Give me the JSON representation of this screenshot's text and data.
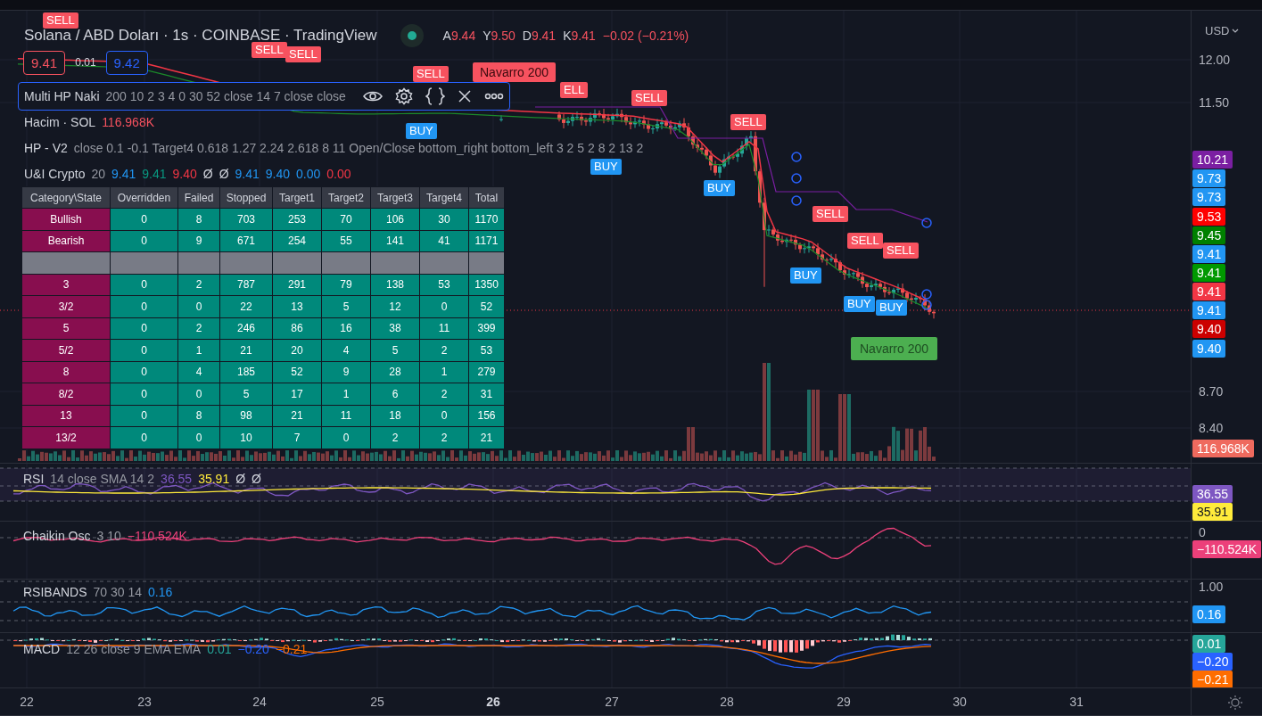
{
  "header": {
    "title": "Solana / ABD Doları · 1s · COINBASE · TradingView",
    "market_open": true,
    "ohlc": [
      {
        "label": "A",
        "value": "9.44"
      },
      {
        "label": "Y",
        "value": "9.50"
      },
      {
        "label": "D",
        "value": "9.41"
      },
      {
        "label": "K",
        "value": "9.41"
      }
    ],
    "change": "−0.02 (−0.21%)"
  },
  "quote_boxes": [
    {
      "text": "9.41",
      "kind": "sell"
    },
    {
      "text": "0.01",
      "kind": "spread"
    },
    {
      "text": "9.42",
      "kind": "buy"
    }
  ],
  "indicators": [
    {
      "name": "Multi HP Naki",
      "params": "200 10 2 3 4 0 30 52 close 14 7 close close",
      "selected": true
    },
    {
      "name": "Hacim · SOL",
      "selected": false,
      "values": [
        {
          "text": "116.968K",
          "color": "#f7525f"
        }
      ]
    },
    {
      "name": "HP - V2",
      "params": "close 0.1 -0.1 Target4 0.618 1.27 2.24 2.618 8 11 Open/Close bottom_right bottom_left 3 2 5 2 8 2 13 2",
      "selected": false
    },
    {
      "name": "U&I Crypto",
      "params": "20",
      "selected": false,
      "values": [
        {
          "text": "9.41",
          "color": "#2196f3"
        },
        {
          "text": "9.41",
          "color": "#089981"
        },
        {
          "text": "9.40",
          "color": "#f23645"
        },
        {
          "text": "Ø",
          "color": "#d1d4dc"
        },
        {
          "text": "Ø",
          "color": "#d1d4dc"
        },
        {
          "text": "9.41",
          "color": "#2196f3"
        },
        {
          "text": "9.40",
          "color": "#2196f3"
        },
        {
          "text": "0.00",
          "color": "#2196f3"
        },
        {
          "text": "0.00",
          "color": "#f23645"
        }
      ]
    }
  ],
  "table": {
    "columns": [
      "Category\\State",
      "Overridden",
      "Failed",
      "Stopped",
      "Target1",
      "Target2",
      "Target3",
      "Target4",
      "Total"
    ],
    "rows": [
      {
        "kind": "data",
        "cells": [
          "Bullish",
          "0",
          "8",
          "703",
          "253",
          "70",
          "106",
          "30",
          "1170"
        ]
      },
      {
        "kind": "data",
        "cells": [
          "Bearish",
          "0",
          "9",
          "671",
          "254",
          "55",
          "141",
          "41",
          "1171"
        ]
      },
      {
        "kind": "separator"
      },
      {
        "kind": "data",
        "cells": [
          "3",
          "0",
          "2",
          "787",
          "291",
          "79",
          "138",
          "53",
          "1350"
        ]
      },
      {
        "kind": "data",
        "cells": [
          "3/2",
          "0",
          "0",
          "22",
          "13",
          "5",
          "12",
          "0",
          "52"
        ]
      },
      {
        "kind": "data",
        "cells": [
          "5",
          "0",
          "2",
          "246",
          "86",
          "16",
          "38",
          "11",
          "399"
        ]
      },
      {
        "kind": "data",
        "cells": [
          "5/2",
          "0",
          "1",
          "21",
          "20",
          "4",
          "5",
          "2",
          "53"
        ]
      },
      {
        "kind": "data",
        "cells": [
          "8",
          "0",
          "4",
          "185",
          "52",
          "9",
          "28",
          "1",
          "279"
        ]
      },
      {
        "kind": "data",
        "cells": [
          "8/2",
          "0",
          "0",
          "5",
          "17",
          "1",
          "6",
          "2",
          "31"
        ]
      },
      {
        "kind": "data",
        "cells": [
          "13",
          "0",
          "8",
          "98",
          "21",
          "11",
          "18",
          "0",
          "156"
        ]
      },
      {
        "kind": "data",
        "cells": [
          "13/2",
          "0",
          "0",
          "10",
          "7",
          "0",
          "2",
          "2",
          "21"
        ]
      }
    ]
  },
  "signals": [
    {
      "kind": "sell",
      "text": "SELL"
    },
    {
      "kind": "sell",
      "text": "SELL"
    },
    {
      "kind": "sell",
      "text": "SELL"
    },
    {
      "kind": "sell",
      "text": "SELL"
    },
    {
      "kind": "note_sell",
      "text": "Navarro 200"
    },
    {
      "kind": "sell",
      "text": "ELL"
    },
    {
      "kind": "sell",
      "text": "SELL"
    },
    {
      "kind": "sell",
      "text": "SELL"
    },
    {
      "kind": "buy",
      "text": "BUY"
    },
    {
      "kind": "sell",
      "text": "SELL"
    },
    {
      "kind": "sell",
      "text": "SELL"
    },
    {
      "kind": "sell",
      "text": "SELL"
    },
    {
      "kind": "buy",
      "text": "BUY"
    },
    {
      "kind": "buy",
      "text": "BUY"
    },
    {
      "kind": "buy",
      "text": "BUY"
    },
    {
      "kind": "note_buy",
      "text": "Navarro 200"
    },
    {
      "kind": "buy",
      "text": "BUY"
    },
    {
      "kind": "buy",
      "text": "BUY"
    }
  ],
  "price_axis": {
    "currency": "USD",
    "ticks": [
      "12.00",
      "11.50",
      "8.70",
      "8.40"
    ],
    "badges": [
      {
        "text": "10.21",
        "color": "#7b1fa2"
      },
      {
        "text": "9.73",
        "color": "#2196f3"
      },
      {
        "text": "9.73",
        "color": "#2196f3"
      },
      {
        "text": "9.53",
        "color": "#ff0000"
      },
      {
        "text": "9.45",
        "color": "#008000"
      },
      {
        "text": "9.41",
        "color": "#2196f3"
      },
      {
        "text": "9.41",
        "color": "#009900"
      },
      {
        "text": "9.41",
        "color": "#f23645"
      },
      {
        "text": "9.41",
        "color": "#2196f3"
      },
      {
        "text": "9.40",
        "color": "#cc0000"
      },
      {
        "text": "9.40",
        "color": "#2196f3"
      },
      {
        "text": "116.968K",
        "color": "#ef6a5e"
      }
    ]
  },
  "panes": [
    {
      "kind": "rsi",
      "name": "RSI",
      "params": "14 close SMA 14 2",
      "values": [
        {
          "text": "36.55",
          "color": "#7e57c2"
        },
        {
          "text": "35.91",
          "color": "#ffeb3b"
        },
        {
          "text": "Ø",
          "color": "#d1d4dc"
        },
        {
          "text": "Ø",
          "color": "#d1d4dc"
        }
      ],
      "badges": [
        {
          "text": "36.55",
          "color": "#7e57c2"
        },
        {
          "text": "35.91",
          "color": "#ffeb3b"
        }
      ]
    },
    {
      "kind": "chaikin",
      "name": "Chaikin Osc",
      "params": "3 10",
      "values": [
        {
          "text": "−110.524K",
          "color": "#ec407a"
        }
      ],
      "ticks": [
        "0"
      ],
      "badges": [
        {
          "text": "−110.524K",
          "color": "#ec407a"
        }
      ]
    },
    {
      "kind": "rsibands",
      "name": "RSIBANDS",
      "params": "70 30 14",
      "values": [
        {
          "text": "0.16",
          "color": "#2196f3"
        }
      ],
      "ticks": [
        "1.00"
      ],
      "badges": [
        {
          "text": "0.16",
          "color": "#2196f3"
        }
      ]
    },
    {
      "kind": "macd",
      "name": "MACD",
      "params": "12 26 close 9 EMA EMA",
      "values": [
        {
          "text": "0.01",
          "color": "#26a69a"
        },
        {
          "text": "−0.20",
          "color": "#2962ff"
        },
        {
          "text": "−0.21",
          "color": "#ff6d00"
        }
      ],
      "badges": [
        {
          "text": "0.01",
          "color": "#26a69a"
        },
        {
          "text": "−0.20",
          "color": "#2962ff"
        },
        {
          "text": "−0.21",
          "color": "#ff6d00"
        }
      ]
    }
  ],
  "time_axis": {
    "labels": [
      {
        "text": "22",
        "bold": false
      },
      {
        "text": "23",
        "bold": false
      },
      {
        "text": "24",
        "bold": false
      },
      {
        "text": "25",
        "bold": false
      },
      {
        "text": "26",
        "bold": true
      },
      {
        "text": "27",
        "bold": false
      },
      {
        "text": "28",
        "bold": false
      },
      {
        "text": "29",
        "bold": false
      },
      {
        "text": "30",
        "bold": false
      },
      {
        "text": "31",
        "bold": false
      }
    ]
  }
}
